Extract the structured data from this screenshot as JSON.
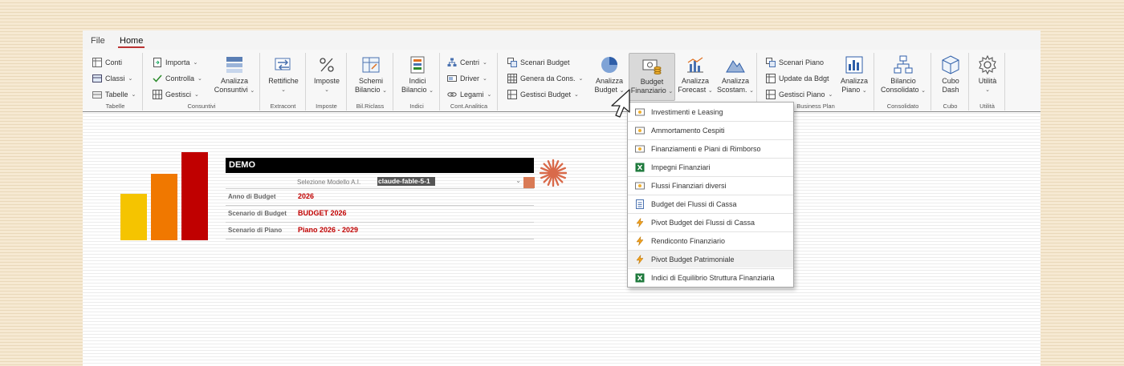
{
  "menu": {
    "file": "File",
    "home": "Home"
  },
  "ribbon": {
    "tabelle": {
      "conti": "Conti",
      "classi": "Classi",
      "tabelle": "Tabelle",
      "label": "Tabelle"
    },
    "consuntivi": {
      "importa": "Importa",
      "controlla": "Controlla",
      "gestisci": "Gestisci",
      "analizza_1": "Analizza",
      "analizza_2": "Consuntivi",
      "label": "Consuntivi"
    },
    "extracont": {
      "rettifiche": "Rettifiche",
      "label": "Extracont"
    },
    "imposte": {
      "imposte": "Imposte",
      "label": "Imposte"
    },
    "bilriclass": {
      "schemi_1": "Schemi",
      "schemi_2": "Bilancio",
      "label": "Bil.Riclass"
    },
    "indici": {
      "indici_1": "Indici",
      "indici_2": "Bilancio",
      "label": "Indici"
    },
    "contanalitica": {
      "centri": "Centri",
      "driver": "Driver",
      "legami": "Legami",
      "label": "Cont.Analitica"
    },
    "budget": {
      "scenari": "Scenari Budget",
      "genera": "Genera da Cons.",
      "gestisci": "Gestisci Budget",
      "analizza_1": "Analizza",
      "analizza_2": "Budget",
      "finanziario_1": "Budget",
      "finanziario_2": "Finanziario",
      "forecast_1": "Analizza",
      "forecast_2": "Forecast",
      "scostam_1": "Analizza",
      "scostam_2": "Scostam."
    },
    "businessplan": {
      "scenari": "Scenari Piano",
      "update": "Update da Bdgt",
      "gestisci": "Gestisci Piano",
      "analizza_1": "Analizza",
      "analizza_2": "Piano",
      "label": "Business Plan"
    },
    "consolidato": {
      "bilancio_1": "Bilancio",
      "bilancio_2": "Consolidato",
      "label": "Consolidato"
    },
    "cubo": {
      "cubo_1": "Cubo",
      "cubo_2": "Dash",
      "label": "Cubo"
    },
    "utilita": {
      "utilita": "Utilità",
      "label": "Utilità"
    }
  },
  "dropdown": {
    "items": [
      "Investimenti e Leasing",
      "Ammortamento Cespiti",
      "Finanziamenti e Piani di Rimborso",
      "Impegni Finanziari",
      "Flussi Finanziari diversi",
      "Budget dei Flussi di Cassa",
      "Pivot Budget dei Flussi di Cassa",
      "Rendiconto Finanziario",
      "Pivot Budget Patrimoniale",
      "Indici di Equilibrio Struttura Finanziaria"
    ]
  },
  "sheet": {
    "title": "DEMO",
    "selezione_label": "Selezione Modello A.I.",
    "selezione_value": "claude-fable-5-1",
    "rows": [
      {
        "label": "Anno di Budget",
        "value": "2026"
      },
      {
        "label": "Scenario di Budget",
        "value": "BUDGET 2026"
      },
      {
        "label": "Scenario di Piano",
        "value": "Piano 2026 - 2029"
      }
    ]
  },
  "colors": {
    "accent": "#c00000",
    "bar1": "#f5c400",
    "bar2": "#f07800",
    "bar3": "#c00000"
  }
}
